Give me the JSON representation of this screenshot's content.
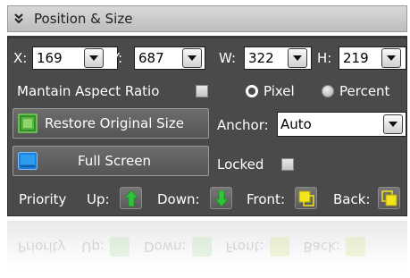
{
  "header": {
    "title": "Position & Size",
    "collapse_icon": "double-chevron-down-icon"
  },
  "position": {
    "x_label": "X:",
    "x_value": "169",
    "y_label": "Y:",
    "y_value": "687",
    "w_label": "W:",
    "w_value": "322",
    "h_label": "H:",
    "h_value": "219"
  },
  "aspect": {
    "label": "Mantain Aspect Ratio",
    "checked": false
  },
  "units": {
    "pixel_label": "Pixel",
    "percent_label": "Percent",
    "selected": "Pixel"
  },
  "restore_button": {
    "label": "Restore Original Size",
    "icon": "resize-icon"
  },
  "full_screen_button": {
    "label": "Full Screen",
    "icon": "fullscreen-icon"
  },
  "anchor": {
    "label": "Anchor:",
    "value": "Auto"
  },
  "locked": {
    "label": "Locked",
    "checked": false
  },
  "priority": {
    "label": "Priority",
    "up_label": "Up:",
    "down_label": "Down:",
    "front_label": "Front:",
    "back_label": "Back:"
  },
  "colors": {
    "panel_bg": "#4a4a4a",
    "header_bg": "#cfcfcf",
    "arrow_green": "#2fc43a",
    "layer_yellow": "#f2e51d"
  }
}
